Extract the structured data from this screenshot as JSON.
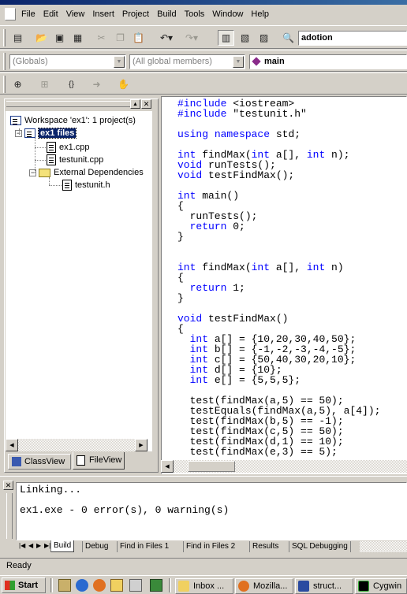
{
  "menu": {
    "items": [
      "File",
      "Edit",
      "View",
      "Insert",
      "Project",
      "Build",
      "Tools",
      "Window",
      "Help"
    ]
  },
  "toolbar": {
    "find_value": "adotion"
  },
  "wizardbar": {
    "class_combo": "(Globals)",
    "filter_combo": "(All global members)",
    "member_combo": "main"
  },
  "workspace": {
    "root": "Workspace 'ex1': 1 project(s)",
    "project": "ex1 files",
    "files": [
      "ex1.cpp",
      "testunit.cpp"
    ],
    "ext_folder": "External Dependencies",
    "ext_files": [
      "testunit.h"
    ],
    "tabs": [
      "ClassView",
      "FileView"
    ]
  },
  "editor": {
    "lines": [
      "#include <iostream>",
      "#include \"testunit.h\"",
      "",
      "using namespace std;",
      "",
      "int findMax(int a[], int n);",
      "void runTests();",
      "void testFindMax();",
      "",
      "int main()",
      "{",
      "  runTests();",
      "  return 0;",
      "}",
      "",
      "",
      "int findMax(int a[], int n)",
      "{",
      "  return 1;",
      "}",
      "",
      "void testFindMax()",
      "{",
      "  int a[] = {10,20,30,40,50};",
      "  int b[] = {-1,-2,-3,-4,-5};",
      "  int c[] = {50,40,30,20,10};",
      "  int d[] = {10};",
      "  int e[] = {5,5,5};",
      "",
      "  test(findMax(a,5) == 50);",
      "  testEquals(findMax(a,5), a[4]);",
      "  test(findMax(b,5) == -1);",
      "  test(findMax(c,5) == 50);",
      "  test(findMax(d,1) == 10);",
      "  test(findMax(e,3) == 5);"
    ],
    "keywords": [
      "#include",
      "using",
      "namespace",
      "int",
      "void",
      "return"
    ]
  },
  "output": {
    "lines": [
      "Linking...",
      "",
      "ex1.exe - 0 error(s), 0 warning(s)"
    ],
    "tabs": [
      "Build",
      "Debug",
      "Find in Files 1",
      "Find in Files 2",
      "Results",
      "SQL Debugging"
    ]
  },
  "status": {
    "text": "Ready"
  },
  "taskbar": {
    "start": "Start",
    "tasks": [
      "Inbox ...",
      "Mozilla...",
      "struct...",
      "Cygwin"
    ]
  }
}
